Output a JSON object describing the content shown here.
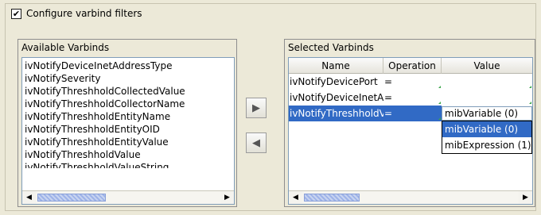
{
  "config": {
    "checkbox_checked": "✔",
    "label": "Configure varbind filters"
  },
  "available": {
    "title": "Available Varbinds",
    "items": [
      "ivNotifyDeviceInetAddressType",
      "ivNotifySeverity",
      "ivNotifyThreshholdCollectedValue",
      "ivNotifyThreshholdCollectorName",
      "ivNotifyThreshholdEntityName",
      "ivNotifyThreshholdEntityOID",
      "ivNotifyThreshholdEntityValue",
      "ivNotifyThreshholdValue",
      "ivNotifyThreshholdValueString"
    ]
  },
  "buttons": {
    "add_glyph": "▶",
    "remove_glyph": "◀"
  },
  "selected": {
    "title": "Selected Varbinds",
    "columns": [
      "Name",
      "Operation",
      "Value"
    ],
    "rows": [
      {
        "name": "ivNotifyDevicePort",
        "operation": "=",
        "value": ""
      },
      {
        "name": "ivNotifyDeviceInetAddress",
        "operation": "=",
        "value": ""
      },
      {
        "name": "ivNotifyThreshholdValue",
        "operation": "=",
        "value": ""
      }
    ],
    "editor_value": "mibVariable (0)",
    "options": [
      "mibVariable (0)",
      "mibExpression (1)"
    ],
    "highlighted_option": "mibVariable (0)"
  },
  "scroll": {
    "left_arrow": "◀",
    "right_arrow": "▶"
  },
  "colors": {
    "selection": "#316ac5",
    "background": "#ece9d8",
    "edit_marker": "#3aa54a"
  }
}
